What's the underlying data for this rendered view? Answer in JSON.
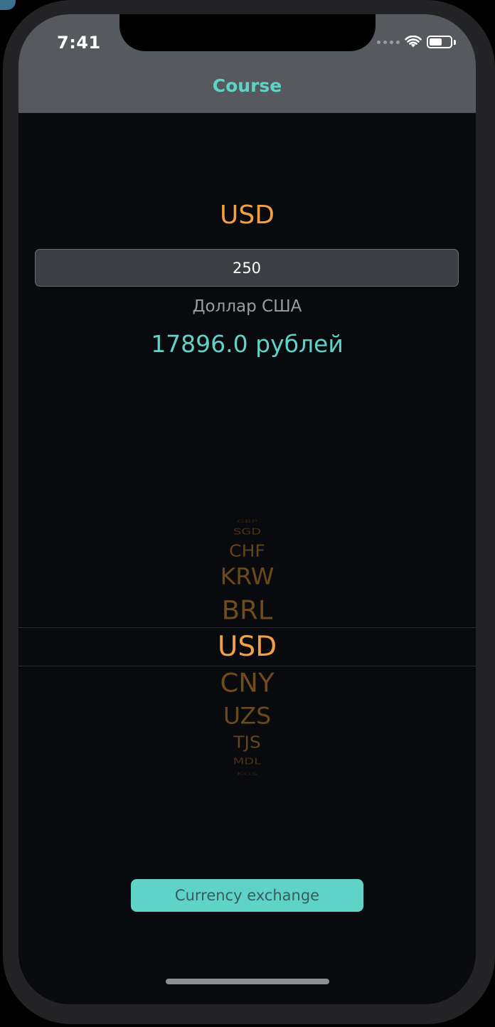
{
  "status_bar": {
    "time": "7:41",
    "battery_level": 0.6
  },
  "nav": {
    "title": "Course"
  },
  "converter": {
    "currency_code": "USD",
    "amount_value": "250",
    "currency_name": "Доллар США",
    "result": "17896.0 рублей"
  },
  "picker": {
    "options": [
      "GBP",
      "SGD",
      "CHF",
      "KRW",
      "BRL",
      "USD",
      "CNY",
      "UZS",
      "TJS",
      "MDL",
      "KGS"
    ],
    "selected": "USD"
  },
  "actions": {
    "exchange_label": "Currency exchange"
  },
  "colors": {
    "accent": "#5fd3c7",
    "highlight": "#f2a042",
    "background": "#080a0d",
    "nav_background": "#56595d"
  }
}
